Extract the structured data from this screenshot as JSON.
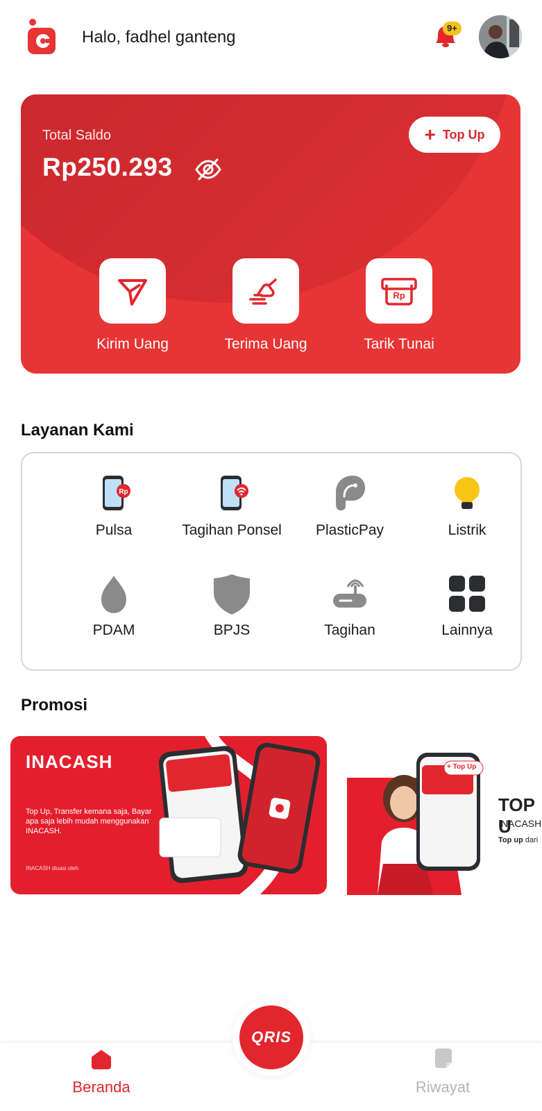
{
  "header": {
    "greeting": "Halo, fadhel ganteng",
    "notification_count": "9+"
  },
  "balance": {
    "label": "Total Saldo",
    "amount": "Rp250.293",
    "topup_label": "Top Up",
    "actions": [
      {
        "label": "Kirim Uang",
        "icon": "send-icon"
      },
      {
        "label": "Terima Uang",
        "icon": "receive-money-icon"
      },
      {
        "label": "Tarik Tunai",
        "icon": "cash-withdraw-icon"
      }
    ]
  },
  "services": {
    "title": "Layanan Kami",
    "items": [
      {
        "label": "Pulsa",
        "icon": "phone-credit-icon"
      },
      {
        "label": "Tagihan Ponsel",
        "icon": "phone-bill-icon"
      },
      {
        "label": "PlasticPay",
        "icon": "plasticpay-icon"
      },
      {
        "label": "Listrik",
        "icon": "lightbulb-icon"
      },
      {
        "label": "PDAM",
        "icon": "water-drop-icon"
      },
      {
        "label": "BPJS",
        "icon": "shield-icon"
      },
      {
        "label": "Tagihan",
        "icon": "router-icon"
      },
      {
        "label": "Lainnya",
        "icon": "grid-icon"
      }
    ]
  },
  "promo": {
    "title": "Promosi",
    "banner1": {
      "brand": "INACASH",
      "text": "Top Up, Transfer kemana saja, Bayar apa saja lebih mudah menggunakan INACASH.",
      "footer": "INACASH diuasi oleh"
    },
    "banner2": {
      "headline": "TOP U",
      "sub": "INACASH",
      "body_bold": "Top up",
      "body": "dari",
      "chip": "+ Top Up"
    }
  },
  "nav": {
    "home": "Beranda",
    "qris": "QRIS",
    "history": "Riwayat"
  },
  "colors": {
    "brand_red": "#e73434",
    "dark_red": "#c3242a",
    "badge_yellow": "#f4c21f",
    "inactive_gray": "#b5b5b5"
  }
}
